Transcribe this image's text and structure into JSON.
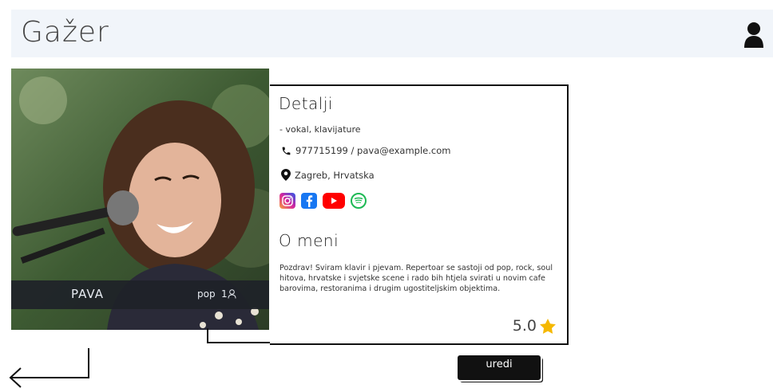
{
  "app": {
    "title": "Gažer"
  },
  "header": {
    "user_icon": "user-icon"
  },
  "artist": {
    "name": "PAVA",
    "genre": "pop",
    "count": "1",
    "photo_icon": "artist-photo"
  },
  "details": {
    "title": "Detalji",
    "role": "- vokal, klavijature",
    "contact": "977715199 / pava@example.com",
    "location": "Zagreb, Hrvatska",
    "socials": [
      {
        "name": "instagram-icon",
        "color": "#d6249f"
      },
      {
        "name": "facebook-icon",
        "color": "#1877f2"
      },
      {
        "name": "youtube-icon",
        "color": "#ff0000"
      },
      {
        "name": "spotify-icon",
        "color": "#1db954"
      }
    ]
  },
  "about": {
    "title": "O meni",
    "text": "Pozdrav! Sviram klavir i pjevam. Repertoar se sastoji od pop, rock, soul hitova, hrvatske i svjetske scene i rado bih htjela svirati u novim cafe barovima, restoranima i drugim ugostiteljskim objektima."
  },
  "rating": {
    "value": "5.0",
    "star_color": "#f5b800"
  },
  "actions": {
    "edit_label": "uredi",
    "back_icon": "back-arrow-icon"
  }
}
